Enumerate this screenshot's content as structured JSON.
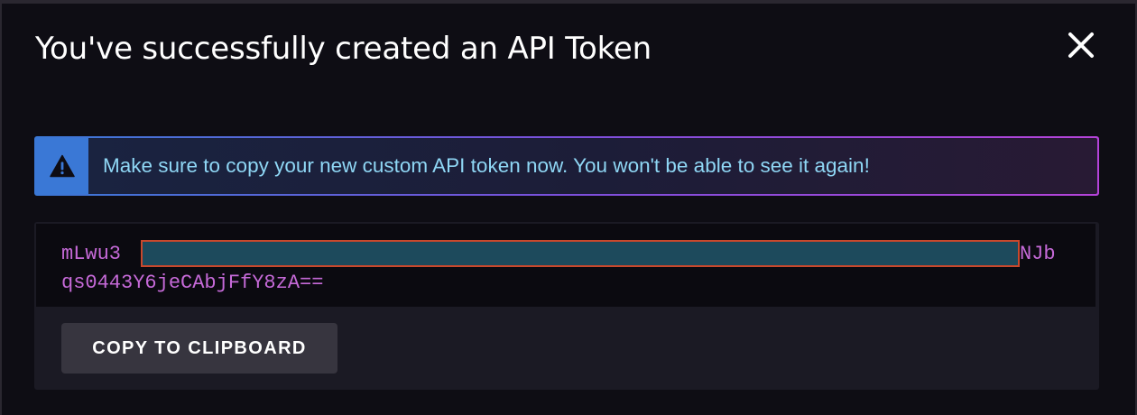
{
  "dialog": {
    "title": "You've successfully created an API Token",
    "close_icon": "close-icon"
  },
  "alert": {
    "icon": "warning-triangle-icon",
    "message": "Make sure to copy your new custom API token now. You won't be able to see it again!",
    "colors": {
      "icon_bg": "#3a78d6",
      "text": "#8fd7f5",
      "border_start": "#3a78d6",
      "border_end": "#b543d9"
    }
  },
  "token": {
    "line1_start": "mLwu3",
    "line1_end": "NJb",
    "line2": "qs0443Y6jeCAbjFfY8zA==",
    "text_color": "#c66ad8"
  },
  "actions": {
    "copy_label": "COPY TO CLIPBOARD"
  }
}
